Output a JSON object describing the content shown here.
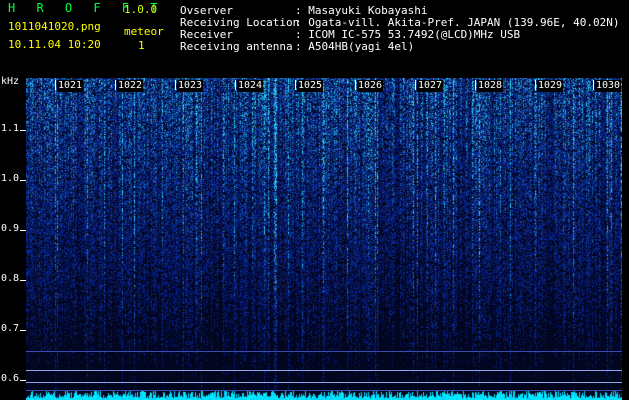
{
  "header": {
    "brand": "H R O F F T",
    "version": "1.0.0",
    "filename": "1011041020.png",
    "datetime": "10.11.04 10:20",
    "meteor_label": "meteor",
    "meteor_count": "1",
    "fields": [
      {
        "label": "Ovserver",
        "value": ": Masayuki Kobayashi"
      },
      {
        "label": "Receiving Location",
        "value": ": Ogata-vill. Akita-Pref. JAPAN (139.96E, 40.02N)"
      },
      {
        "label": "Receiver",
        "value": ": ICOM IC-575 53.7492(@LCD)MHz USB"
      },
      {
        "label": "Receiving antenna",
        "value": ": A504HB(yagi 4el)"
      }
    ]
  },
  "yaxis": {
    "unit": "kHz",
    "labels": [
      "1.1",
      "1.0",
      "0.9",
      "0.8",
      "0.7",
      "0.6"
    ]
  },
  "xaxis": {
    "minutes": [
      "1021",
      "1022",
      "1023",
      "1024",
      "1025",
      "1026",
      "1027",
      "1028",
      "1029",
      "1030"
    ]
  },
  "colors": {
    "background": "#000000",
    "accent_green": "#00ff40",
    "accent_yellow": "#ffff00",
    "spectrum_low": "#0a1a8c",
    "spectrum_high": "#30ff90"
  }
}
